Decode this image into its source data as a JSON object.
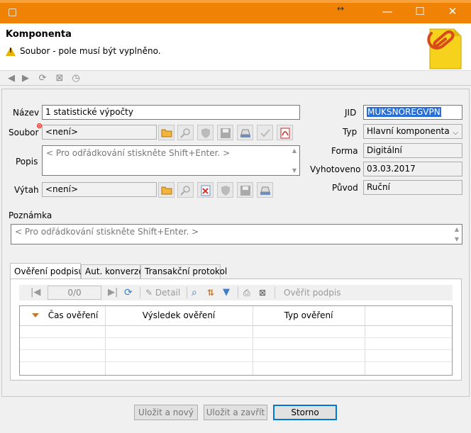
{
  "window": {
    "min_label": "—",
    "max_label": "☐",
    "close_label": "✕",
    "resize_label": "↔"
  },
  "header": {
    "title": "Komponenta",
    "warning": "Soubor - pole musí být vyplněno."
  },
  "form": {
    "nazev_label": "Název",
    "nazev_value": "1 statistické výpočty",
    "soubor_label": "Soubor",
    "soubor_value": "<není>",
    "popis_label": "Popis",
    "popis_placeholder": "< Pro odřádkování stiskněte Shift+Enter. >",
    "vytah_label": "Výtah",
    "vytah_value": "<není>",
    "poznamka_label": "Poznámka",
    "poznamka_placeholder": "< Pro odřádkování stiskněte Shift+Enter. >",
    "jid_label": "JID",
    "jid_value": "MUKSNOREGVPN",
    "typ_label": "Typ",
    "typ_value": "Hlavní komponenta",
    "forma_label": "Forma",
    "forma_value": "Digitální",
    "vyhotoveno_label": "Vyhotoveno",
    "vyhotoveno_value": "03.03.2017",
    "puvod_label": "Původ",
    "puvod_value": "Ruční"
  },
  "tabs": [
    {
      "label": "Ověření podpisu",
      "active": true
    },
    {
      "label": "Aut. konverze",
      "active": false
    },
    {
      "label": "Transakční protokol",
      "active": false
    }
  ],
  "grid_toolbar": {
    "pager": "0/0",
    "detail_label": "Detail",
    "verify_label": "Ověřit podpis"
  },
  "grid": {
    "columns": [
      "Čas ověření",
      "Výsledek ověření",
      "Typ ověření"
    ]
  },
  "footer": {
    "save_new": "Uložit a nový",
    "save_close": "Uložit a zavřít",
    "cancel": "Storno"
  },
  "colors": {
    "titlebar": "#f08306",
    "selection": "#2a6fd6",
    "error_marker": "#d9332b"
  }
}
